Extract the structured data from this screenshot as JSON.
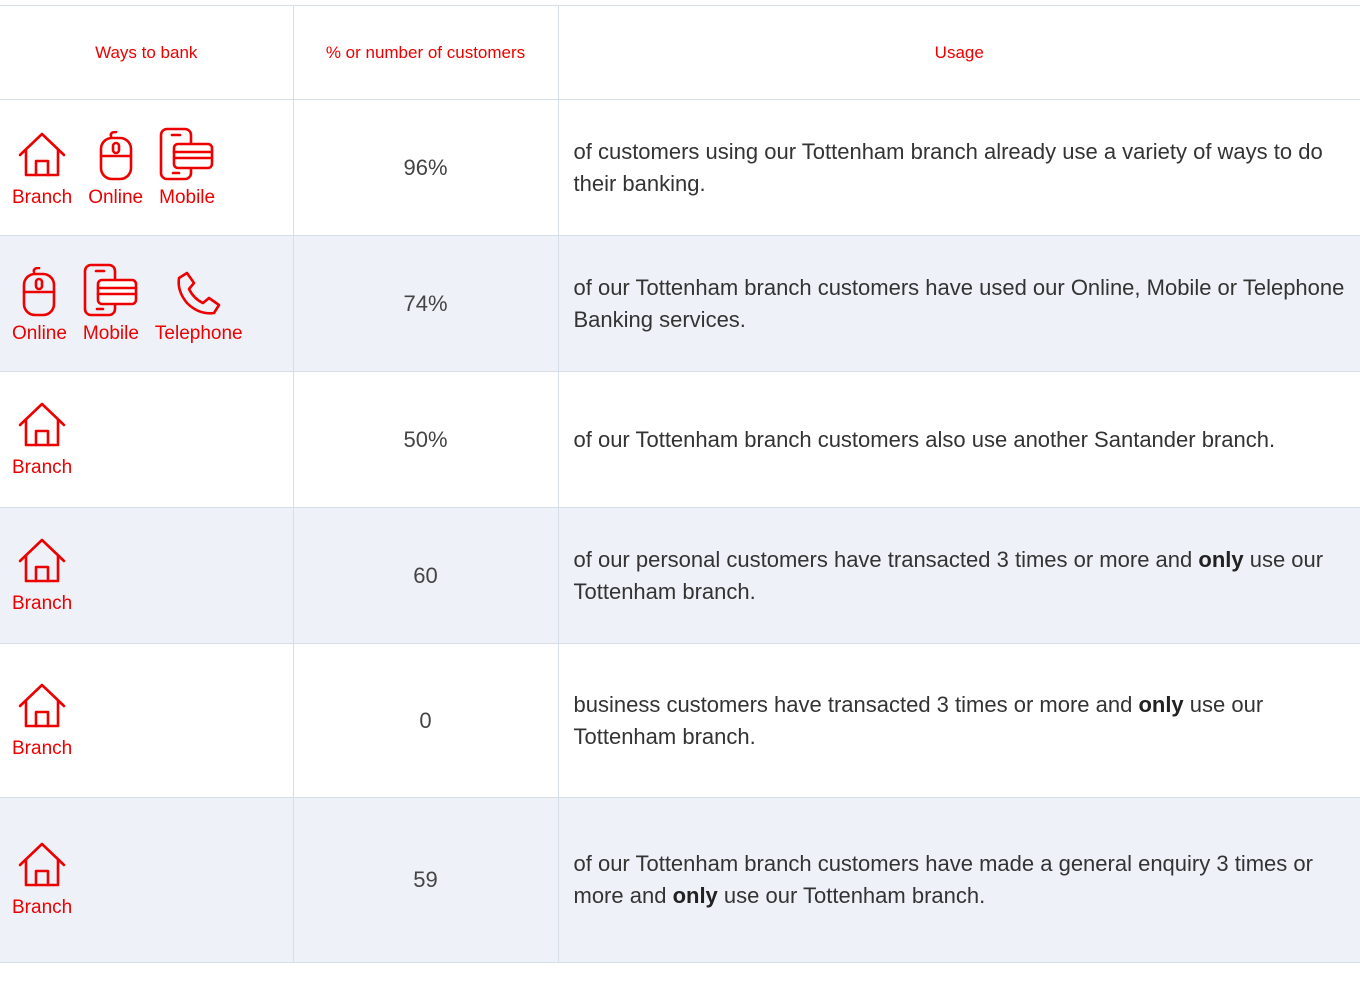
{
  "headers": {
    "ways": "Ways to bank",
    "count": "% or number of customers",
    "usage": "Usage"
  },
  "icon_color": "#ec0000",
  "rows": [
    {
      "channels": [
        {
          "label": "Branch",
          "icon": "branch-house-icon"
        },
        {
          "label": "Online",
          "icon": "online-mouse-icon"
        },
        {
          "label": "Mobile",
          "icon": "mobile-phone-icon"
        }
      ],
      "count": "96%",
      "usage": {
        "pre": "of customers using our Tottenham branch already use a variety of ways to do their banking.",
        "bold": "",
        "post": ""
      }
    },
    {
      "channels": [
        {
          "label": "Online",
          "icon": "online-mouse-icon"
        },
        {
          "label": "Mobile",
          "icon": "mobile-phone-icon"
        },
        {
          "label": "Telephone",
          "icon": "telephone-icon"
        }
      ],
      "count": "74%",
      "usage": {
        "pre": "of our Tottenham branch customers have used our Online, Mobile or Telephone Banking services.",
        "bold": "",
        "post": ""
      }
    },
    {
      "channels": [
        {
          "label": "Branch",
          "icon": "branch-house-icon"
        }
      ],
      "count": "50%",
      "usage": {
        "pre": "of our Tottenham branch customers also use another Santander branch.",
        "bold": "",
        "post": ""
      }
    },
    {
      "channels": [
        {
          "label": "Branch",
          "icon": "branch-house-icon"
        }
      ],
      "count": "60",
      "usage": {
        "pre": "of our personal customers have transacted 3 times or more and ",
        "bold": "only",
        "post": " use our Tottenham branch."
      }
    },
    {
      "channels": [
        {
          "label": "Branch",
          "icon": "branch-house-icon"
        }
      ],
      "count": "0",
      "usage": {
        "pre": "business customers have transacted 3 times or more and ",
        "bold": "only",
        "post": " use our Tottenham branch."
      }
    },
    {
      "channels": [
        {
          "label": "Branch",
          "icon": "branch-house-icon"
        }
      ],
      "count": "59",
      "usage": {
        "pre": "of our Tottenham branch customers have made a general enquiry 3 times or more and ",
        "bold": "only",
        "post": " use our Tottenham branch."
      }
    }
  ]
}
